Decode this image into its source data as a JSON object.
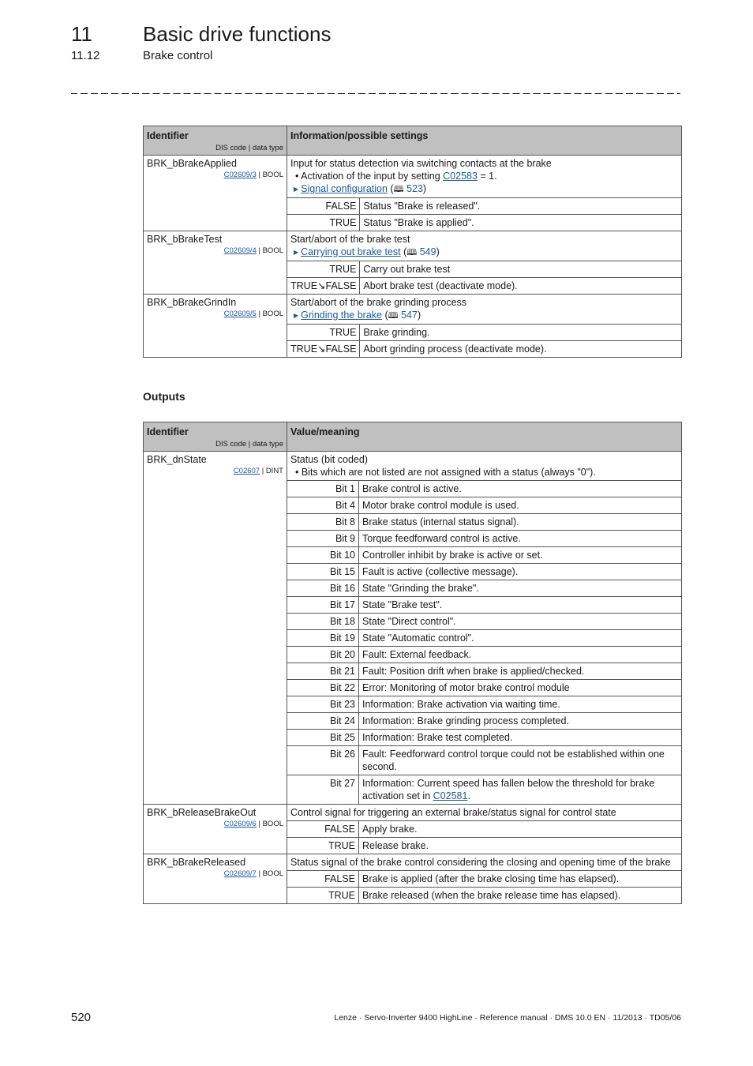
{
  "header": {
    "chapter_number": "11",
    "chapter_title": "Basic drive functions",
    "section_number": "11.12",
    "section_title": "Brake control"
  },
  "inputs_table": {
    "col_identifier": "Identifier",
    "col_identifier_sub": "DIS code | data type",
    "col_info": "Information/possible settings",
    "rows": [
      {
        "identifier": "BRK_bBrakeApplied",
        "code": "C02609/3",
        "type": "| BOOL",
        "description": "Input for status detection via switching contacts at the brake",
        "bullet_prefix": "• Activation of the input by setting ",
        "bullet_link": "C02583",
        "bullet_suffix": " = 1.",
        "ref_link": "Signal configuration",
        "ref_page": "523",
        "values": [
          {
            "value": "FALSE",
            "meaning": "Status \"Brake is released\"."
          },
          {
            "value": "TRUE",
            "meaning": "Status \"Brake is applied\"."
          }
        ]
      },
      {
        "identifier": "BRK_bBrakeTest",
        "code": "C02609/4",
        "type": "| BOOL",
        "description": "Start/abort of the brake test",
        "ref_link": "Carrying out brake test",
        "ref_page": "549",
        "values": [
          {
            "value": "TRUE",
            "meaning": "Carry out brake test"
          },
          {
            "value": "TRUE↘FALSE",
            "meaning": "Abort brake test (deactivate mode)."
          }
        ]
      },
      {
        "identifier": "BRK_bBrakeGrindIn",
        "code": "C02609/5",
        "type": "| BOOL",
        "description": "Start/abort of the brake grinding process",
        "ref_link": "Grinding the brake",
        "ref_page": "547",
        "values": [
          {
            "value": "TRUE",
            "meaning": "Brake grinding."
          },
          {
            "value": "TRUE↘FALSE",
            "meaning": "Abort grinding process (deactivate mode)."
          }
        ]
      }
    ]
  },
  "outputs_heading": "Outputs",
  "outputs_table": {
    "col_identifier": "Identifier",
    "col_identifier_sub": "DIS code | data type",
    "col_value": "Value/meaning",
    "dnstate": {
      "identifier": "BRK_dnState",
      "code": "C02607",
      "type": "| DINT",
      "description": "Status (bit coded)",
      "bullet": "• Bits which are not listed are not assigned with a status (always \"0\").",
      "bits": [
        {
          "value": "Bit 1",
          "meaning": "Brake control is active."
        },
        {
          "value": "Bit 4",
          "meaning": "Motor brake control module is used."
        },
        {
          "value": "Bit 8",
          "meaning": "Brake status (internal status signal)."
        },
        {
          "value": "Bit 9",
          "meaning": "Torque feedforward control is active."
        },
        {
          "value": "Bit 10",
          "meaning": "Controller inhibit by brake is active or set."
        },
        {
          "value": "Bit 15",
          "meaning": "Fault is active (collective message)."
        },
        {
          "value": "Bit 16",
          "meaning": "State \"Grinding the brake\"."
        },
        {
          "value": "Bit 17",
          "meaning": "State \"Brake test\"."
        },
        {
          "value": "Bit 18",
          "meaning": "State \"Direct control\"."
        },
        {
          "value": "Bit 19",
          "meaning": "State \"Automatic control\"."
        },
        {
          "value": "Bit 20",
          "meaning": "Fault: External feedback."
        },
        {
          "value": "Bit 21",
          "meaning": "Fault: Position drift when brake is applied/checked."
        },
        {
          "value": "Bit 22",
          "meaning": "Error: Monitoring of motor brake control module"
        },
        {
          "value": "Bit 23",
          "meaning": "Information: Brake activation via waiting time."
        },
        {
          "value": "Bit 24",
          "meaning": "Information: Brake grinding process completed."
        },
        {
          "value": "Bit 25",
          "meaning": "Information: Brake test completed."
        },
        {
          "value": "Bit 26",
          "meaning": "Fault: Feedforward control torque could not be established within one second."
        }
      ],
      "bit27_value": "Bit 27",
      "bit27_prefix": "Information: Current speed has fallen below the threshold for brake activation set in ",
      "bit27_link": "C02581",
      "bit27_suffix": "."
    },
    "release_out": {
      "identifier": "BRK_bReleaseBrakeOut",
      "code": "C02609/6",
      "type": "| BOOL",
      "description": "Control signal for triggering an external brake/status signal for control state",
      "values": [
        {
          "value": "FALSE",
          "meaning": "Apply brake."
        },
        {
          "value": "TRUE",
          "meaning": "Release brake."
        }
      ]
    },
    "released": {
      "identifier": "BRK_bBrakeReleased",
      "code": "C02609/7",
      "type": "| BOOL",
      "description": "Status signal of the brake control considering the closing and opening time of the brake",
      "values": [
        {
          "value": "FALSE",
          "meaning": "Brake is applied (after the brake closing time has elapsed)."
        },
        {
          "value": "TRUE",
          "meaning": "Brake released (when the brake release time has elapsed)."
        }
      ]
    }
  },
  "footer": {
    "page_number": "520",
    "text": "Lenze · Servo-Inverter 9400 HighLine · Reference manual · DMS 10.0 EN · 11/2013 · TD05/06"
  },
  "icons": {
    "ref_arrow": "▶",
    "book": "🕮"
  }
}
